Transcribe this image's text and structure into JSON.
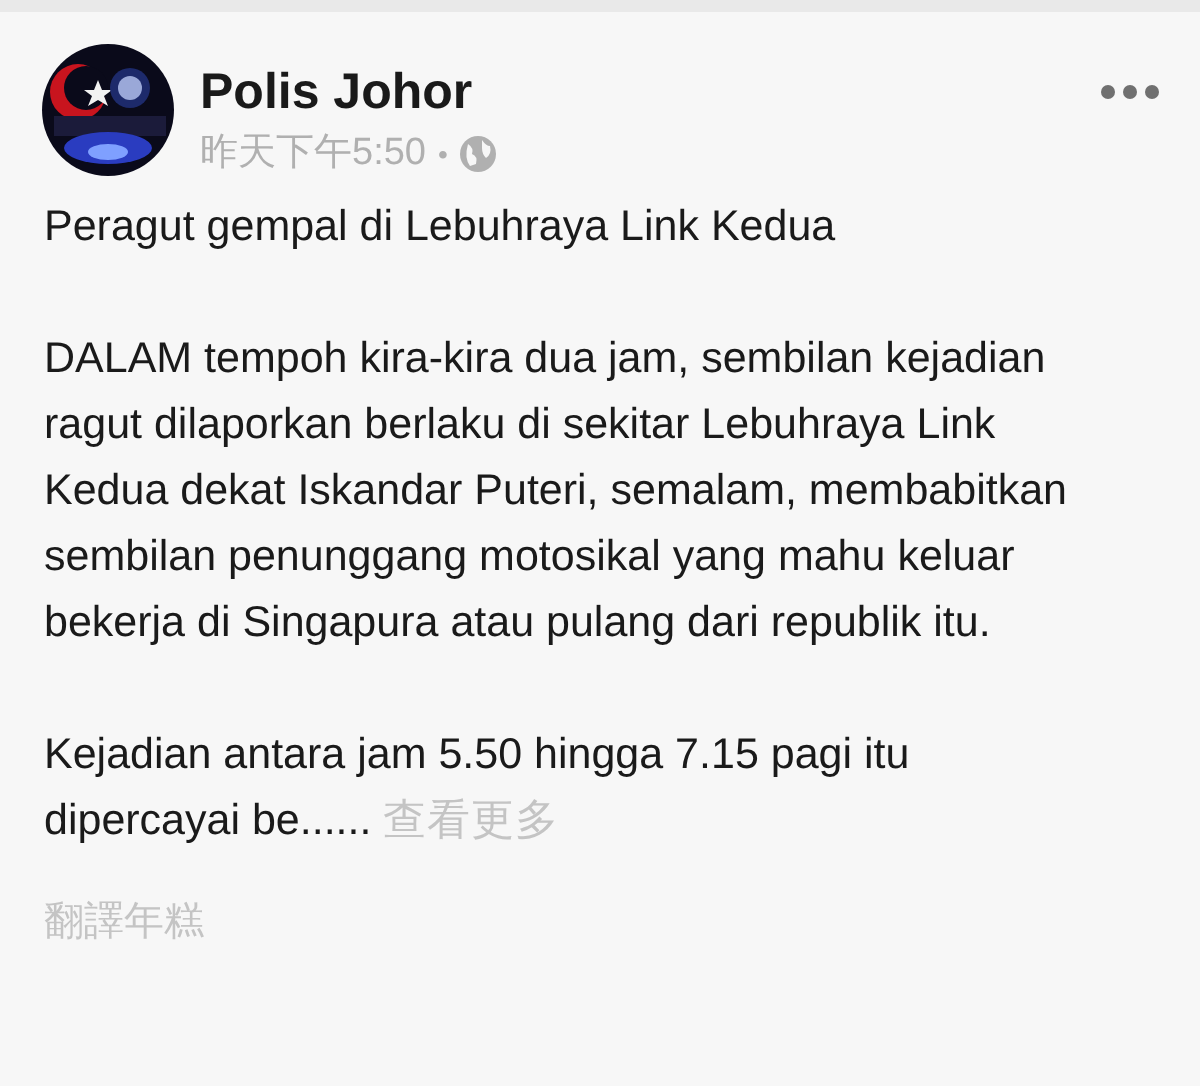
{
  "post": {
    "author": "Polis Johor",
    "time": "昨天下午5:50",
    "separator": "•",
    "title": "Peragut gempal di Lebuhraya Link Kedua",
    "paragraphs": [
      "DALAM tempoh kira-kira dua jam, sembilan kejadian ragut dilaporkan berlaku di sekitar Lebuhraya Link Kedua dekat Iskandar Puteri, semalam, membabitkan sembilan penunggang motosikal yang mahu keluar bekerja di Singapura atau pulang dari republik itu.",
      "Kejadian antara jam 5.50 hingga 7.15 pagi itu dipercayai be......"
    ],
    "see_more": "查看更多",
    "translate": "翻譯年糕"
  }
}
